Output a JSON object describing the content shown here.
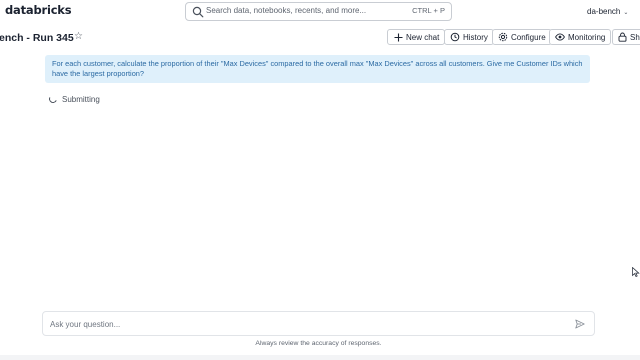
{
  "app": {
    "logo": "databricks"
  },
  "search": {
    "placeholder": "Search data, notebooks, recents, and more...",
    "shortcut": "CTRL + P"
  },
  "user": {
    "workspace": "da-bench"
  },
  "page": {
    "title": "ench - Run 345"
  },
  "toolbar": {
    "new_chat": "New chat",
    "history": "History",
    "configure": "Configure",
    "monitoring": "Monitoring",
    "share": "Sha"
  },
  "conversation": {
    "question": "For each customer, calculate the proportion of their \"Max Devices\" compared to the overall max \"Max Devices\" across all customers. Give me Customer IDs which have the largest proportion?",
    "status": "Submitting"
  },
  "composer": {
    "placeholder": "Ask your question..."
  },
  "footer": {
    "disclaimer": "Always review the accuracy of responses."
  }
}
